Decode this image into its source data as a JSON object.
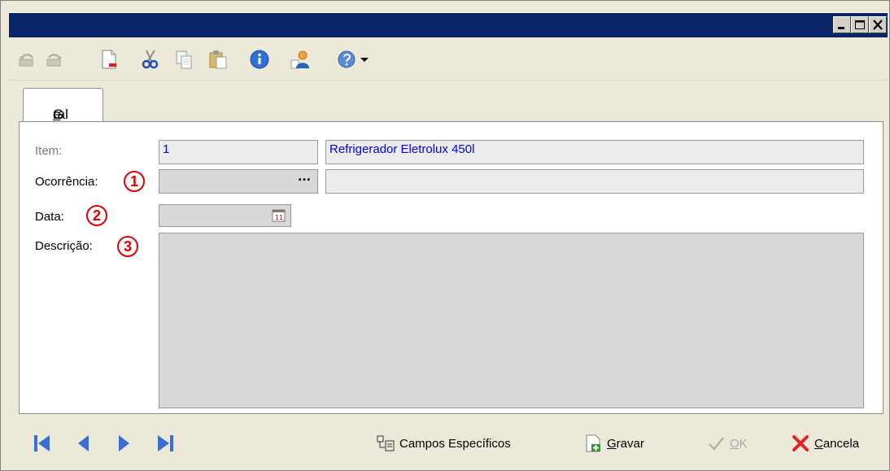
{
  "window": {
    "title": "",
    "controls": [
      "minimize",
      "maximize",
      "close"
    ]
  },
  "toolbar": {
    "buttons": [
      {
        "icon": "undo-icon",
        "enabled": false
      },
      {
        "icon": "redo-icon",
        "enabled": false
      },
      {
        "icon": "new-document-icon",
        "enabled": true
      },
      {
        "icon": "cut-icon",
        "enabled": true
      },
      {
        "icon": "copy-icon",
        "enabled": true
      },
      {
        "icon": "paste-icon",
        "enabled": true
      },
      {
        "icon": "info-icon",
        "enabled": true
      },
      {
        "icon": "user-icon",
        "enabled": true
      },
      {
        "icon": "help-icon",
        "enabled": true
      }
    ]
  },
  "tabs": [
    {
      "label_pre": "G",
      "label_underline": "e",
      "label_post": "ral",
      "selected": true
    }
  ],
  "form": {
    "item": {
      "label": "Item:",
      "code": "1",
      "description": "Refrigerador Eletrolux 450l"
    },
    "ocorrencia": {
      "label": "Ocorrência:",
      "marker": "1",
      "lookup_button": "...",
      "code": "",
      "description": ""
    },
    "data": {
      "label": "Data:",
      "marker": "2",
      "value": ""
    },
    "descricao": {
      "label": "Descrição:",
      "marker": "3",
      "value": ""
    }
  },
  "footer": {
    "nav": [
      "first-record-icon",
      "previous-record-icon",
      "next-record-icon",
      "last-record-icon"
    ],
    "campos_label": "Campos Específicos",
    "gravar": {
      "underline": "G",
      "rest": "ravar"
    },
    "ok": {
      "underline": "O",
      "rest": "K",
      "enabled": false
    },
    "cancela": {
      "underline": "C",
      "rest": "ancela"
    }
  },
  "colors": {
    "titlebar": "#0a246a",
    "annotation": "#e00000",
    "link_text": "#0000ee",
    "window_bg": "#ece9d8"
  }
}
